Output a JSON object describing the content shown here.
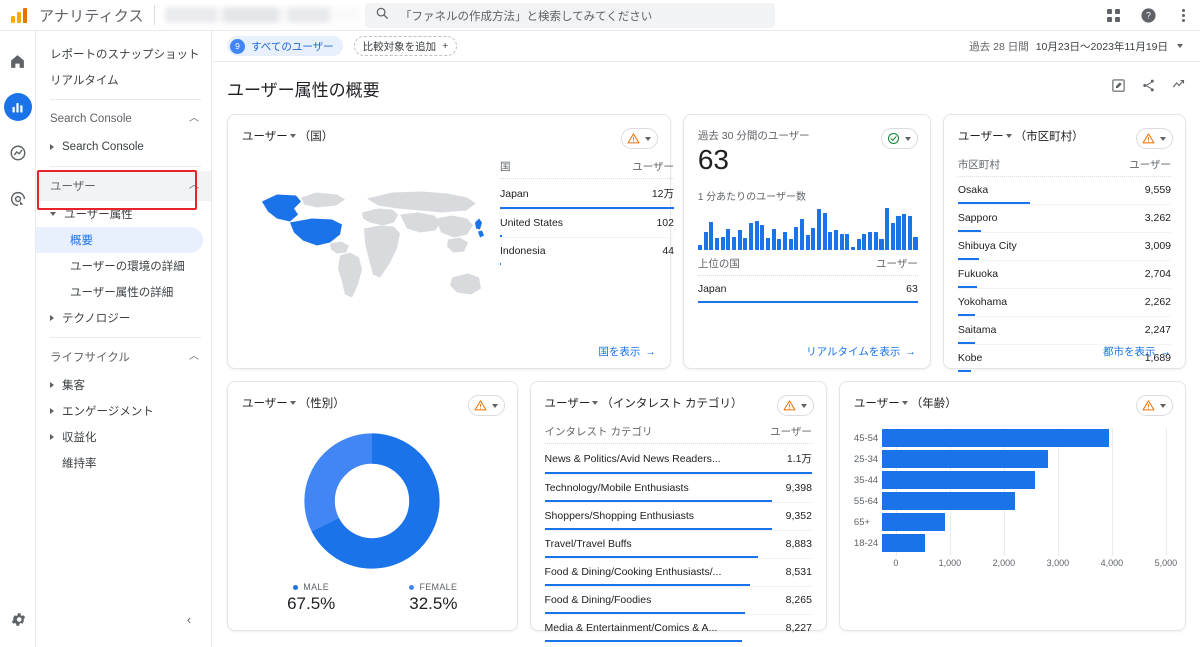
{
  "topbar": {
    "brand": "アナリティクス",
    "account_blurred": "",
    "search_placeholder": "「ファネルの作成方法」と検索してみてください",
    "icons": {
      "search": "search-icon",
      "apps": "apps-grid-icon",
      "help": "help-icon",
      "more": "more-vert-icon"
    }
  },
  "rail": {
    "items": [
      {
        "name": "home-icon",
        "label": "ホーム"
      },
      {
        "name": "reports-icon",
        "label": "レポート"
      },
      {
        "name": "explore-icon",
        "label": "探索"
      },
      {
        "name": "advertising-icon",
        "label": "広告"
      }
    ],
    "settings": {
      "name": "gear-icon",
      "label": "管理"
    }
  },
  "sidebar": {
    "top_items": [
      {
        "label": "レポートのスナップショット"
      },
      {
        "label": "リアルタイム"
      }
    ],
    "sections": [
      {
        "label": "Search Console",
        "items": [
          {
            "label": "Search Console",
            "expandable": true
          }
        ]
      },
      {
        "label": "ユーザー",
        "items": [
          {
            "label": "ユーザー属性",
            "expandable": true,
            "expanded": true
          },
          {
            "label": "概要",
            "sub": true,
            "selected": true
          },
          {
            "label": "ユーザーの環境の詳細",
            "sub": true
          },
          {
            "label": "ユーザー属性の詳細",
            "sub": true
          },
          {
            "label": "テクノロジー",
            "expandable": true
          }
        ]
      },
      {
        "label": "ライフサイクル",
        "items": [
          {
            "label": "集客",
            "expandable": true
          },
          {
            "label": "エンゲージメント",
            "expandable": true
          },
          {
            "label": "収益化",
            "expandable": true
          },
          {
            "label": "維持率"
          }
        ]
      }
    ],
    "collapse_label": "‹"
  },
  "context": {
    "all_users_chip": "すべてのユーザー",
    "all_users_badge": "9",
    "add_comparison": "比較対象を追加",
    "add_comparison_plus": "+",
    "date_label": "過去 28 日間",
    "date_range": "10月23日〜2023年11月19日"
  },
  "page": {
    "title": "ユーザー属性の概要",
    "actions": [
      {
        "name": "customize-report-icon"
      },
      {
        "name": "share-icon"
      },
      {
        "name": "insights-icon"
      }
    ]
  },
  "cards": {
    "country": {
      "title_metric": "ユーザー",
      "title_dim": "（国）",
      "badge_icon": "warning-triangle-icon",
      "col_dim": "国",
      "col_metric": "ユーザー",
      "rows": [
        {
          "name": "Japan",
          "value": "12万",
          "pct": 100
        },
        {
          "name": "United States",
          "value": "102",
          "pct": 1
        },
        {
          "name": "Indonesia",
          "value": "44",
          "pct": 0.6
        }
      ],
      "link": "国を表示"
    },
    "realtime": {
      "label": "過去 30 分間のユーザー",
      "value": "63",
      "sub_label": "1 分あたりのユーザー数",
      "badge_icon": "check-circle-icon",
      "col_dim": "上位の国",
      "col_metric": "ユーザー",
      "rows": [
        {
          "name": "Japan",
          "value": "63",
          "pct": 100
        }
      ],
      "link": "リアルタイムを表示",
      "sparkline": [
        8,
        30,
        46,
        20,
        22,
        34,
        22,
        32,
        20,
        44,
        48,
        40,
        20,
        34,
        18,
        30,
        18,
        38,
        50,
        24,
        36,
        66,
        60,
        30,
        32,
        26,
        26,
        4,
        18,
        26,
        30,
        30,
        18,
        68,
        44,
        56,
        58,
        56,
        22
      ]
    },
    "city": {
      "title_metric": "ユーザー",
      "title_dim": "（市区町村）",
      "badge_icon": "warning-triangle-icon",
      "col_dim": "市区町村",
      "col_metric": "ユーザー",
      "rows": [
        {
          "name": "Osaka",
          "value": "9,559",
          "pct": 100
        },
        {
          "name": "Sapporo",
          "value": "3,262",
          "pct": 34
        },
        {
          "name": "Shibuya City",
          "value": "3,009",
          "pct": 31
        },
        {
          "name": "Fukuoka",
          "value": "2,704",
          "pct": 28
        },
        {
          "name": "Yokohama",
          "value": "2,262",
          "pct": 24
        },
        {
          "name": "Saitama",
          "value": "2,247",
          "pct": 23
        },
        {
          "name": "Kobe",
          "value": "1,689",
          "pct": 18
        }
      ],
      "link": "都市を表示"
    },
    "gender": {
      "title_metric": "ユーザー",
      "title_dim": "（性別）",
      "badge_icon": "warning-triangle-icon",
      "segments": [
        {
          "label": "MALE",
          "value": "67.5%",
          "pct": 67.5,
          "color": "#1a73e8"
        },
        {
          "label": "FEMALE",
          "value": "32.5%",
          "pct": 32.5,
          "color": "#4285f4"
        }
      ]
    },
    "interest": {
      "title_metric": "ユーザー",
      "title_dim": "（インタレスト カテゴリ）",
      "badge_icon": "warning-triangle-icon",
      "col_dim": "インタレスト カテゴリ",
      "col_metric": "ユーザー",
      "rows": [
        {
          "name": "News & Politics/Avid News Readers...",
          "value": "1.1万",
          "pct": 100
        },
        {
          "name": "Technology/Mobile Enthusiasts",
          "value": "9,398",
          "pct": 85
        },
        {
          "name": "Shoppers/Shopping Enthusiasts",
          "value": "9,352",
          "pct": 85
        },
        {
          "name": "Travel/Travel Buffs",
          "value": "8,883",
          "pct": 80
        },
        {
          "name": "Food & Dining/Cooking Enthusiasts/...",
          "value": "8,531",
          "pct": 77
        },
        {
          "name": "Food & Dining/Foodies",
          "value": "8,265",
          "pct": 75
        },
        {
          "name": "Media & Entertainment/Comics & A...",
          "value": "8,227",
          "pct": 74
        }
      ]
    },
    "age": {
      "title_metric": "ユーザー",
      "title_dim": "（年齢）",
      "badge_icon": "warning-triangle-icon"
    }
  },
  "chart_data": [
    {
      "type": "bar",
      "title": "ユーザー（年齢）",
      "orientation": "horizontal",
      "categories": [
        "45-54",
        "25-34",
        "35-44",
        "55-64",
        "65+",
        "18-24"
      ],
      "values": [
        4200,
        3080,
        2840,
        2460,
        1160,
        800
      ],
      "xlabel": "",
      "ylabel": "",
      "xlim": [
        0,
        5000
      ],
      "xticks": [
        "0",
        "1,000",
        "2,000",
        "3,000",
        "4,000",
        "5,000"
      ],
      "grid": true,
      "legend": "none",
      "color": "#1a73e8"
    },
    {
      "type": "pie",
      "title": "ユーザー（性別）",
      "subtype": "donut",
      "categories": [
        "MALE",
        "FEMALE"
      ],
      "values": [
        67.5,
        32.5
      ],
      "labels": [
        "67.5%",
        "32.5%"
      ],
      "colors": [
        "#1a73e8",
        "#4285f4"
      ],
      "legend": "bottom"
    },
    {
      "type": "bar",
      "title": "1 分あたりのユーザー数",
      "orientation": "vertical",
      "categories": [
        "-30",
        "-29",
        "-28",
        "-27",
        "-26",
        "-25",
        "-24",
        "-23",
        "-22",
        "-21",
        "-20",
        "-19",
        "-18",
        "-17",
        "-16",
        "-15",
        "-14",
        "-13",
        "-12",
        "-11",
        "-10",
        "-9",
        "-8",
        "-7",
        "-6",
        "-5",
        "-4",
        "-3",
        "-2",
        "-1"
      ],
      "values": [
        8,
        30,
        46,
        20,
        22,
        34,
        22,
        32,
        20,
        44,
        48,
        40,
        20,
        34,
        18,
        30,
        18,
        38,
        50,
        24,
        36,
        66,
        60,
        30,
        32,
        26,
        26,
        4,
        18,
        26
      ],
      "grid": false,
      "legend": "none",
      "color": "#1a73e8"
    },
    {
      "type": "table",
      "title": "ユーザー（国）",
      "columns": [
        "国",
        "ユーザー"
      ],
      "rows": [
        [
          "Japan",
          "12万"
        ],
        [
          "United States",
          "102"
        ],
        [
          "Indonesia",
          "44"
        ]
      ]
    },
    {
      "type": "table",
      "title": "ユーザー（市区町村）",
      "columns": [
        "市区町村",
        "ユーザー"
      ],
      "rows": [
        [
          "Osaka",
          "9,559"
        ],
        [
          "Sapporo",
          "3,262"
        ],
        [
          "Shibuya City",
          "3,009"
        ],
        [
          "Fukuoka",
          "2,704"
        ],
        [
          "Yokohama",
          "2,262"
        ],
        [
          "Saitama",
          "2,247"
        ],
        [
          "Kobe",
          "1,689"
        ]
      ]
    },
    {
      "type": "table",
      "title": "ユーザー（インタレスト カテゴリ）",
      "columns": [
        "インタレスト カテゴリ",
        "ユーザー"
      ],
      "rows": [
        [
          "News & Politics/Avid News Readers...",
          "1.1万"
        ],
        [
          "Technology/Mobile Enthusiasts",
          "9,398"
        ],
        [
          "Shoppers/Shopping Enthusiasts",
          "9,352"
        ],
        [
          "Travel/Travel Buffs",
          "8,883"
        ],
        [
          "Food & Dining/Cooking Enthusiasts/...",
          "8,531"
        ],
        [
          "Food & Dining/Foodies",
          "8,265"
        ],
        [
          "Media & Entertainment/Comics & A...",
          "8,227"
        ]
      ]
    }
  ],
  "colors": {
    "accent": "#1a73e8",
    "accent_light": "#4285f4",
    "warning": "#e8710a",
    "success": "#188038",
    "highlight_box": "#e8232a",
    "map_selected": "#1a73e8",
    "map_base": "#d8dadd"
  }
}
